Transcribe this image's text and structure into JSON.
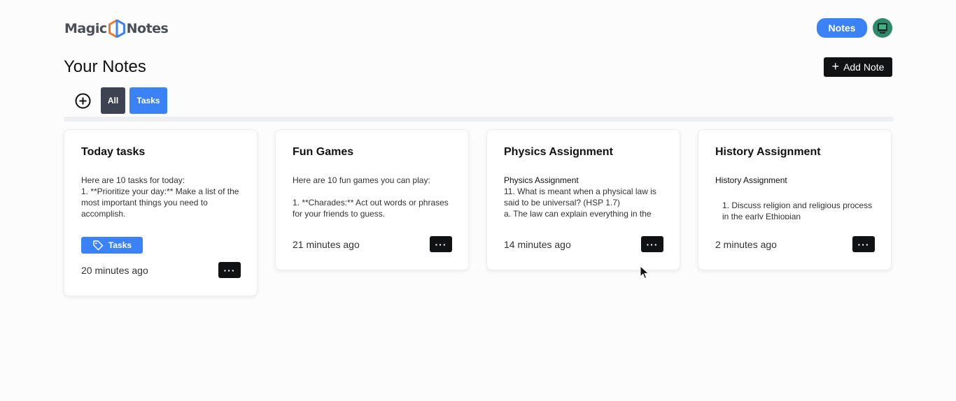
{
  "header": {
    "logo_left": "Magic",
    "logo_right": "Notes",
    "notes_button": "Notes",
    "avatar_icon": "avatar-icon"
  },
  "main": {
    "title": "Your Notes",
    "add_note_label": "Add Note",
    "filters": {
      "add_tag_icon": "plus-circle-icon",
      "all": "All",
      "tasks": "Tasks"
    }
  },
  "cards": [
    {
      "title": "Today tasks",
      "body": "Here are 10 tasks for today:\n1. **Prioritize your day:** Make a list of the most important things you need to accomplish.",
      "tag": "Tasks",
      "time": "20 minutes ago"
    },
    {
      "title": "Fun Games",
      "body": "Here are 10 fun games you can play:\n\n1. **Charades:** Act out words or phrases for your friends to guess.",
      "time": "21 minutes ago"
    },
    {
      "title": "Physics Assignment",
      "body_heading": "Physics Assignment",
      "body": "11. What is meant when a physical law is said to be universal? (HSP 1.7)\na. The law can explain everything in the",
      "time": "14 minutes ago"
    },
    {
      "title": "History Assignment",
      "body_heading": "History Assignment",
      "body_item": "1. Discuss religion and religious process in the early Ethiopian",
      "time": "2 minutes ago"
    }
  ],
  "colors": {
    "accent": "#3b82f6",
    "dark_button": "#111214",
    "filter_all": "#3d4350"
  }
}
